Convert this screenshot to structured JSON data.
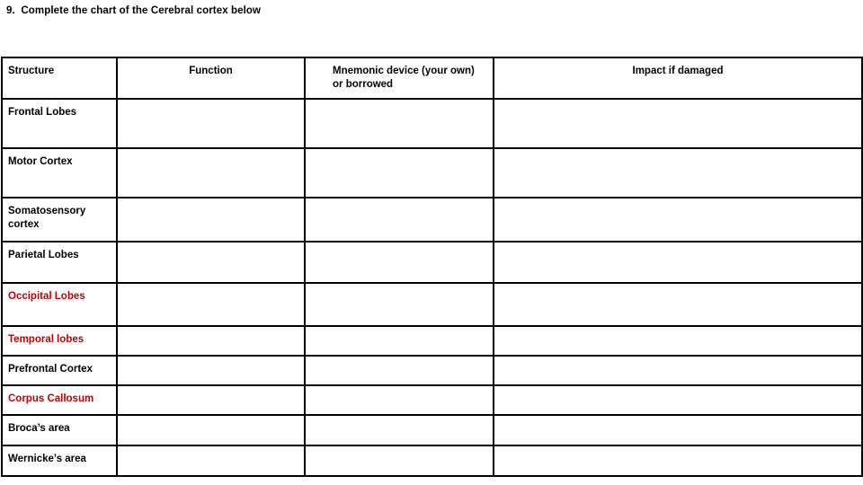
{
  "document": {
    "question": "9.  Complete the chart of the Cerebral cortex below",
    "accent_red": "#C00000",
    "text_color": "#000000",
    "background": "#FFFFFF"
  },
  "table": {
    "headers": [
      {
        "label": "Structure",
        "align": "left"
      },
      {
        "label": "Function",
        "align": "center"
      },
      {
        "label": "Mnemonic device (your own)\nor borrowed",
        "align": "left-indent"
      },
      {
        "label": "Impact if damaged",
        "align": "center"
      }
    ],
    "rows": [
      {
        "structure": "Frontal Lobes",
        "highlight": false,
        "function": "",
        "mnemonic": "",
        "impact": ""
      },
      {
        "structure": "Motor Cortex",
        "highlight": false,
        "function": "",
        "mnemonic": "",
        "impact": ""
      },
      {
        "structure": "Somatosensory\ncortex",
        "highlight": false,
        "function": "",
        "mnemonic": "",
        "impact": ""
      },
      {
        "structure": "Parietal Lobes",
        "highlight": false,
        "function": "",
        "mnemonic": "",
        "impact": ""
      },
      {
        "structure": "Occipital Lobes",
        "highlight": true,
        "function": "",
        "mnemonic": "",
        "impact": ""
      },
      {
        "structure": "Temporal lobes",
        "highlight": true,
        "function": "",
        "mnemonic": "",
        "impact": ""
      },
      {
        "structure": "Prefrontal Cortex",
        "highlight": false,
        "function": "",
        "mnemonic": "",
        "impact": ""
      },
      {
        "structure": "Corpus Callosum",
        "highlight": true,
        "function": "",
        "mnemonic": "",
        "impact": ""
      },
      {
        "structure": "Broca’s area",
        "highlight": false,
        "function": "",
        "mnemonic": "",
        "impact": ""
      },
      {
        "structure": "Wernicke’s area",
        "highlight": false,
        "function": "",
        "mnemonic": "",
        "impact": ""
      }
    ]
  }
}
